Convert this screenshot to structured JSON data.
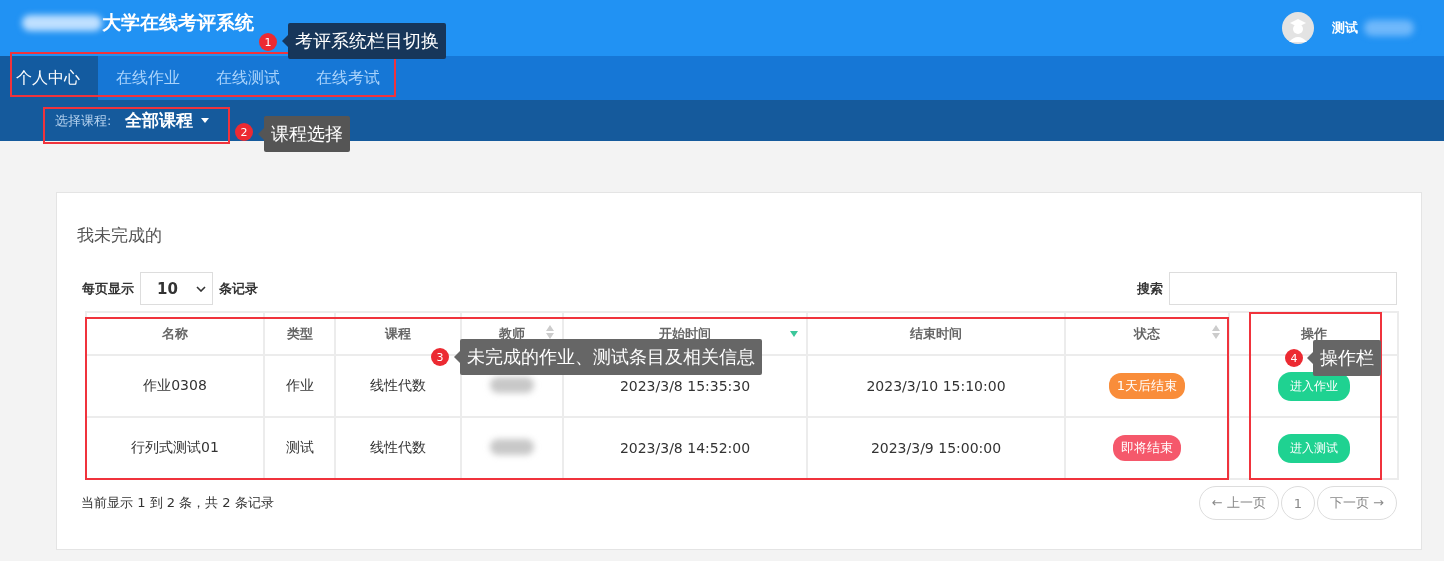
{
  "header": {
    "title": "大学在线考评系统",
    "user": "测试"
  },
  "nav_tabs": [
    {
      "label": "个人中心",
      "selected": true
    },
    {
      "label": "在线作业",
      "selected": false
    },
    {
      "label": "在线测试",
      "selected": false
    },
    {
      "label": "在线考试",
      "selected": false
    }
  ],
  "course_selector": {
    "label": "选择课程:",
    "value": "全部课程"
  },
  "card": {
    "title": "我未完成的",
    "page_size": {
      "prefix": "每页显示",
      "value": "10",
      "suffix": "条记录"
    },
    "search": {
      "label": "搜索"
    },
    "table": {
      "columns": [
        {
          "label": "名称",
          "sortable": false,
          "sorted": false
        },
        {
          "label": "类型",
          "sortable": false,
          "sorted": false
        },
        {
          "label": "课程",
          "sortable": false,
          "sorted": false
        },
        {
          "label": "教师",
          "sortable": true,
          "sorted": false
        },
        {
          "label": "开始时间",
          "sortable": true,
          "sorted": true
        },
        {
          "label": "结束时间",
          "sortable": false,
          "sorted": false
        },
        {
          "label": "状态",
          "sortable": true,
          "sorted": false
        },
        {
          "label": "操作",
          "sortable": false,
          "sorted": false
        }
      ],
      "rows": [
        {
          "name": "作业0308",
          "type": "作业",
          "course": "线性代数",
          "start": "2023/3/8 15:35:30",
          "end": "2023/3/10 15:10:00",
          "status": "1天后结束",
          "color": "#f98d3a",
          "action": "进入作业"
        },
        {
          "name": "行列式测试01",
          "type": "测试",
          "course": "线性代数",
          "start": "2023/3/8 14:52:00",
          "end": "2023/3/9 15:00:00",
          "status": "即将结束",
          "color": "#f5586b",
          "action": "进入测试"
        }
      ]
    },
    "info": "当前显示 1 到 2 条，共 2 条记录",
    "pagination": {
      "prev": "← 上一页",
      "page": "1",
      "next": "下一页 →"
    }
  },
  "annotations": [
    {
      "number": "1",
      "text": "考评系统栏目切换"
    },
    {
      "number": "2",
      "text": "课程选择"
    },
    {
      "number": "3",
      "text": "未完成的作业、测试条目及相关信息"
    },
    {
      "number": "4",
      "text": "操作栏"
    }
  ]
}
